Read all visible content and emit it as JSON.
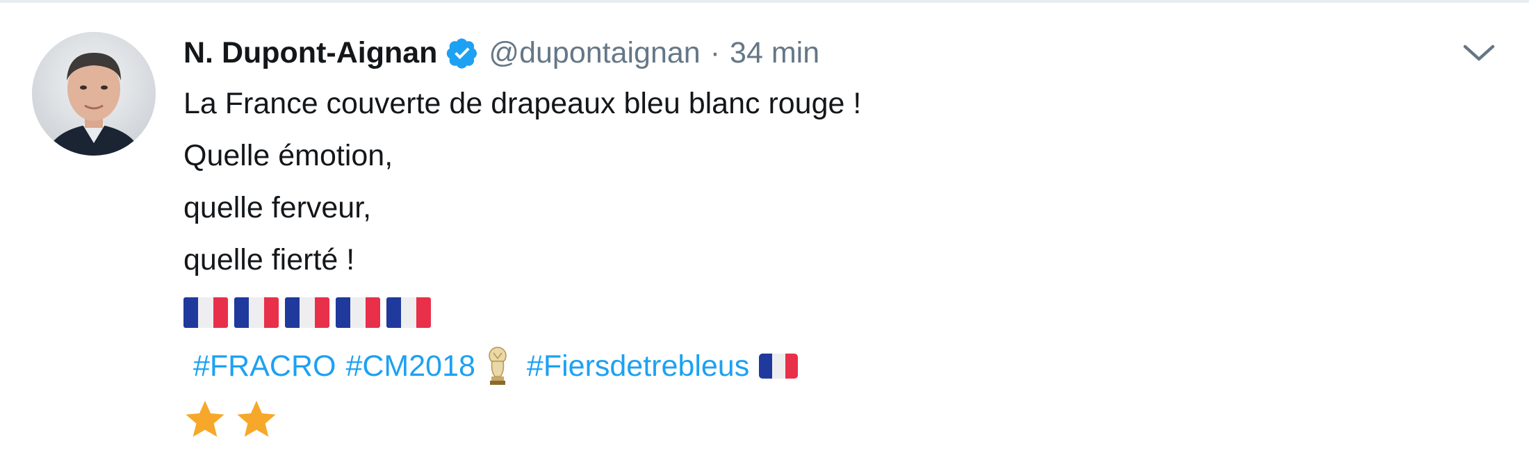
{
  "tweet": {
    "author": {
      "name": "N. Dupont-Aignan",
      "handle": "@dupontaignan",
      "verified": true,
      "avatar_icon": "profile-photo"
    },
    "separator": "·",
    "timestamp": "34 min",
    "lines": [
      "La France couverte de drapeaux bleu blanc rouge !",
      "Quelle émotion,",
      "quelle ferveur,",
      "quelle fierté !"
    ],
    "flag_emoji_count": 5,
    "hashtags": [
      "#FRACRO",
      "#CM2018",
      "#Fiersdetrebleus"
    ],
    "star_emoji_count": 2,
    "menu_icon": "chevron-down-icon"
  },
  "colors": {
    "link": "#1da1f2",
    "secondary": "#657786",
    "primary": "#14171a",
    "flag_blue": "#1f3a9c",
    "flag_white": "#eeeef1",
    "flag_red": "#e8304a",
    "star": "#f7a82a"
  }
}
